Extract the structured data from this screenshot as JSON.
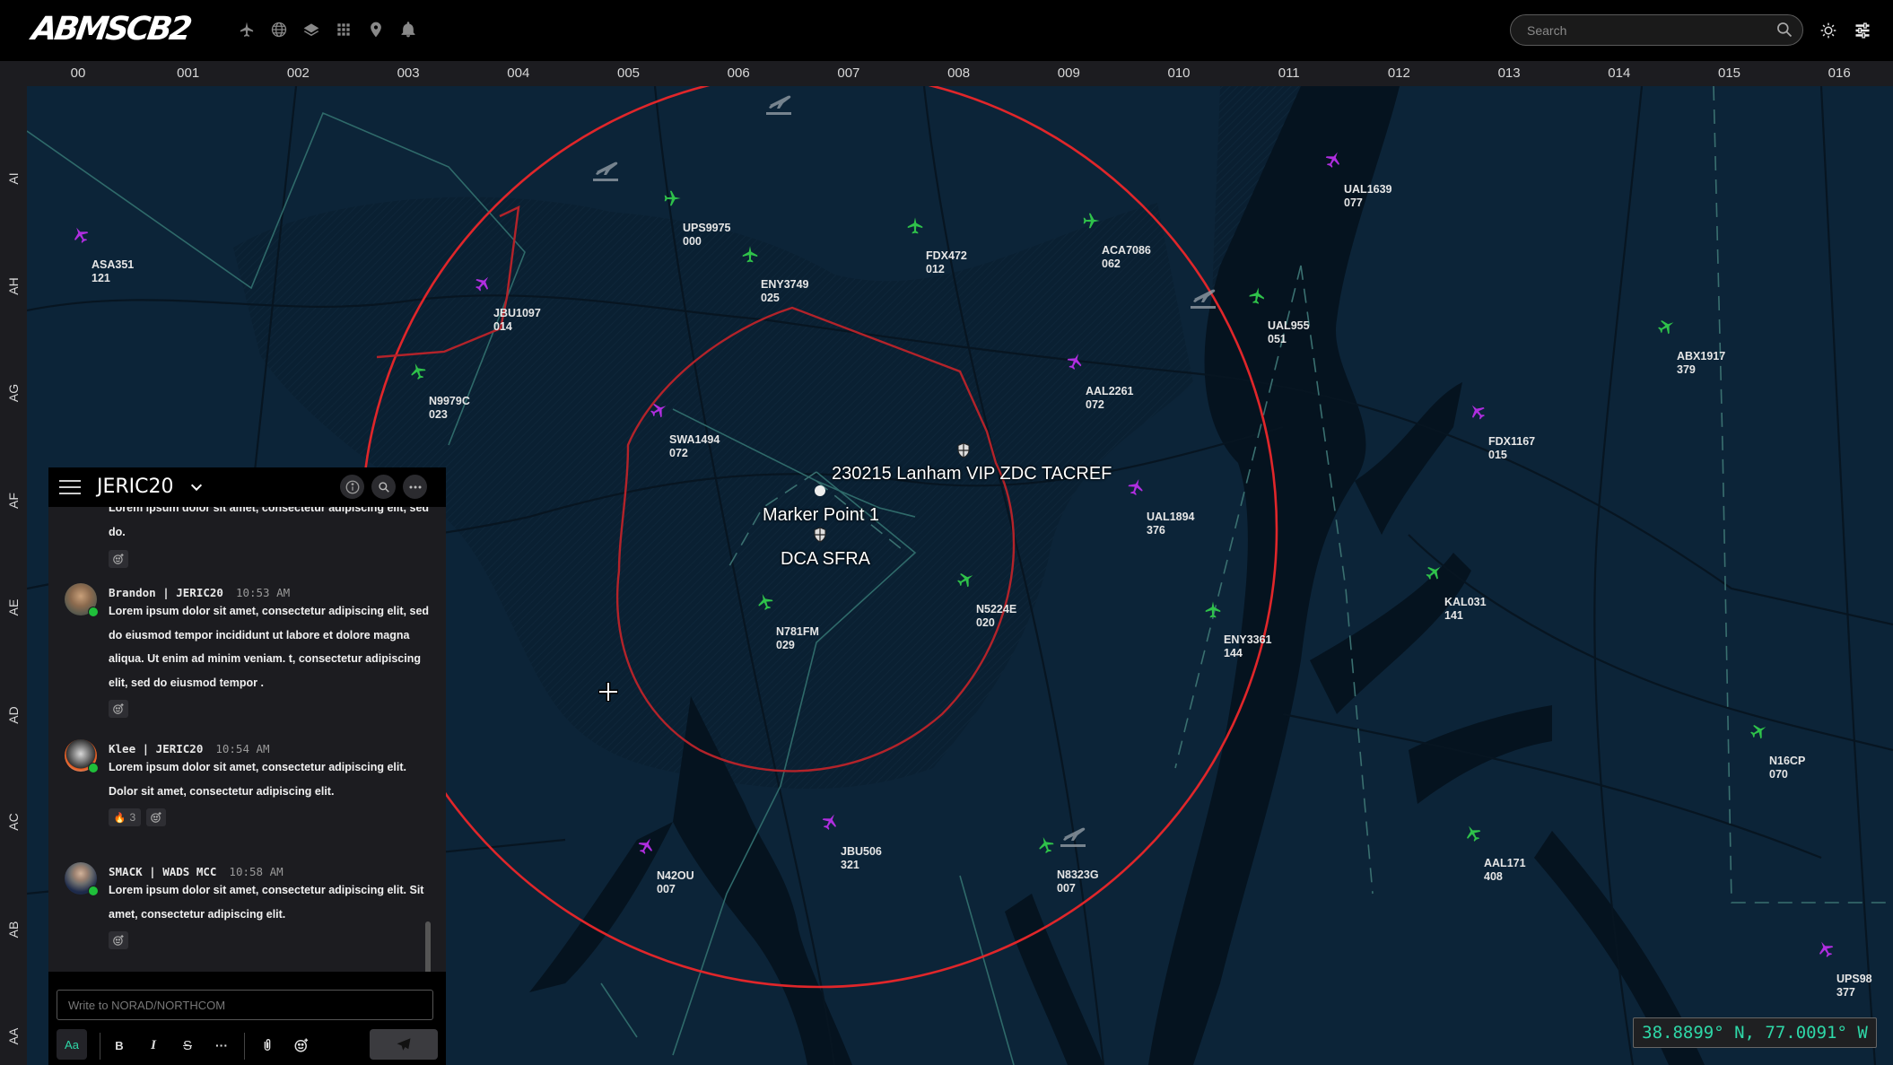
{
  "header": {
    "logo": "ABMSCB2",
    "icons": [
      "aircraft-icon",
      "globe-icon",
      "layers-icon",
      "apps-grid-icon",
      "location-pin-icon",
      "bell-icon"
    ],
    "search_placeholder": "Search",
    "theme_icon": "sun-icon",
    "settings_icon": "sliders-icon"
  },
  "grid": {
    "columns": [
      "00",
      "001",
      "002",
      "003",
      "004",
      "005",
      "006",
      "007",
      "008",
      "009",
      "010",
      "011",
      "012",
      "013",
      "014",
      "015",
      "016"
    ],
    "rows": [
      "AI",
      "AH",
      "AG",
      "AF",
      "AE",
      "AD",
      "AC",
      "AB",
      "AA"
    ]
  },
  "colors": {
    "friendly": "#2fc24a",
    "unknown": "#b02ee0",
    "restricted_ring": "#e0262a",
    "coord_text": "#2ed8a8",
    "map_bg": "#0c2438"
  },
  "map": {
    "labels": {
      "tacref": "230215 Lanham VIP ZDC TACREF",
      "marker": "Marker Point 1",
      "sfra": "DCA SFRA"
    },
    "aircraft": [
      {
        "callsign": "ASA351",
        "alt": "121",
        "type": "unknown"
      },
      {
        "callsign": "JBU1097",
        "alt": "014",
        "type": "unknown"
      },
      {
        "callsign": "N9979C",
        "alt": "023",
        "type": "friendly"
      },
      {
        "callsign": "UPS9975",
        "alt": "000",
        "type": "friendly"
      },
      {
        "callsign": "ENY3749",
        "alt": "025",
        "type": "friendly"
      },
      {
        "callsign": "FDX472",
        "alt": "012",
        "type": "friendly"
      },
      {
        "callsign": "ACA7086",
        "alt": "062",
        "type": "friendly"
      },
      {
        "callsign": "UAL1639",
        "alt": "077",
        "type": "unknown"
      },
      {
        "callsign": "UAL955",
        "alt": "051",
        "type": "friendly"
      },
      {
        "callsign": "ABX1917",
        "alt": "379",
        "type": "friendly"
      },
      {
        "callsign": "AAL2261",
        "alt": "072",
        "type": "unknown"
      },
      {
        "callsign": "SWA1494",
        "alt": "072",
        "type": "unknown"
      },
      {
        "callsign": "FDX1167",
        "alt": "015",
        "type": "unknown"
      },
      {
        "callsign": "UAL1894",
        "alt": "376",
        "type": "unknown"
      },
      {
        "callsign": "KAL031",
        "alt": "141",
        "type": "friendly"
      },
      {
        "callsign": "N5224E",
        "alt": "020",
        "type": "friendly"
      },
      {
        "callsign": "N781FM",
        "alt": "029",
        "type": "friendly"
      },
      {
        "callsign": "ENY3361",
        "alt": "144",
        "type": "friendly"
      },
      {
        "callsign": "N16CP",
        "alt": "070",
        "type": "friendly"
      },
      {
        "callsign": "AAL171",
        "alt": "408",
        "type": "friendly"
      },
      {
        "callsign": "N42OU",
        "alt": "007",
        "type": "unknown"
      },
      {
        "callsign": "JBU506",
        "alt": "321",
        "type": "unknown"
      },
      {
        "callsign": "N8323G",
        "alt": "007",
        "type": "friendly"
      },
      {
        "callsign": "UPS98",
        "alt": "377",
        "type": "unknown"
      }
    ],
    "coordinates": "38.8899° N, 77.0091° W"
  },
  "chat": {
    "channel": "JERIC20",
    "header_buttons": [
      "info-icon",
      "search-icon",
      "more-icon"
    ],
    "messages": [
      {
        "author": "",
        "time": "",
        "text": "Lorem ipsum dolor sit amet, consectetur adipiscing elit, sed do."
      },
      {
        "author": "Brandon | JERIC20",
        "time": "10:53 AM",
        "text": "Lorem ipsum dolor sit amet, consectetur adipiscing elit, sed do eiusmod tempor incididunt ut labore et dolore magna aliqua. Ut enim ad minim veniam. t, consectetur adipiscing elit, sed do eiusmod tempor ."
      },
      {
        "author": "Klee | JERIC20",
        "time": "10:54 AM",
        "text": "Lorem ipsum dolor sit amet, consectetur adipiscing elit. Dolor sit amet, consectetur adipiscing elit.",
        "reaction": {
          "emoji": "🔥",
          "count": "3"
        }
      },
      {
        "author": "SMACK | WADS MCC",
        "time": "10:58 AM",
        "text": "Lorem ipsum dolor sit amet, consectetur adipiscing elit. Sit amet, consectetur adipiscing elit."
      }
    ],
    "compose_placeholder": "Write to NORAD/NORTHCOM",
    "toolbar": {
      "format": "Aa",
      "bold": "B",
      "italic": "I",
      "strike": "S",
      "more": "···"
    }
  }
}
